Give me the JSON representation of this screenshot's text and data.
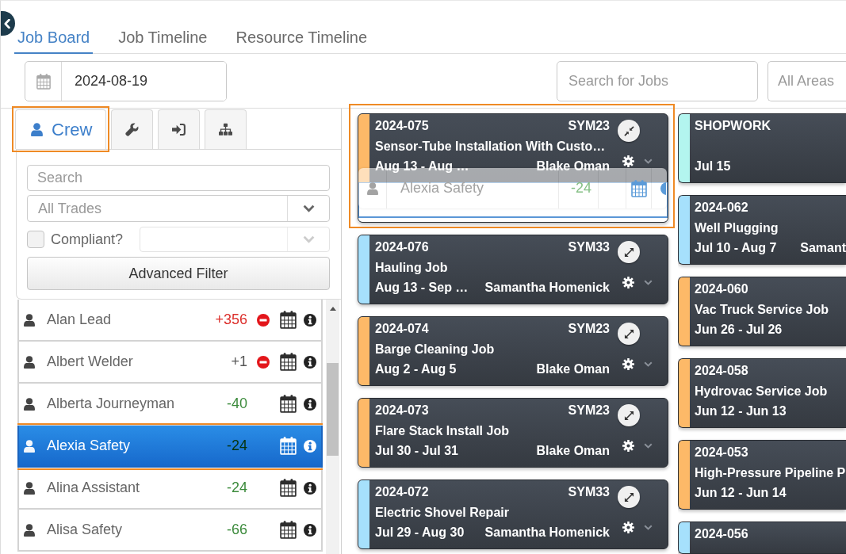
{
  "tabs": [
    {
      "label": "Job Board",
      "selected": true
    },
    {
      "label": "Job Timeline",
      "selected": false
    },
    {
      "label": "Resource Timeline",
      "selected": false
    }
  ],
  "toolbar": {
    "date": {
      "value": "2024-08-19"
    },
    "job_search": {
      "placeholder": "Search for Jobs"
    },
    "area_select": {
      "placeholder": "All Areas"
    }
  },
  "side_panel": {
    "tabs": [
      {
        "kind": "user",
        "label": "Crew",
        "selected": true,
        "highlighted": true
      },
      {
        "kind": "wrench",
        "selected": false,
        "highlighted": false
      },
      {
        "kind": "sign-in",
        "selected": false,
        "highlighted": false
      },
      {
        "kind": "sitemap",
        "selected": false,
        "highlighted": false
      }
    ],
    "filters": {
      "search": {
        "placeholder": "Search"
      },
      "trade_select": {
        "placeholder": "All Trades"
      },
      "compliant": {
        "label": "Compliant?",
        "checked": false
      },
      "compliance_select": {
        "disabled": true
      },
      "advanced_button": "Advanced Filter"
    },
    "crew": [
      {
        "name": "Alan Lead",
        "hours": "+356",
        "color": "#dc2f2b",
        "conflict": true,
        "selected": false,
        "highlighted": false
      },
      {
        "name": "Albert Welder",
        "hours": "+1",
        "color": "#555555",
        "conflict": true,
        "selected": false,
        "highlighted": false
      },
      {
        "name": "Alberta Journeyman",
        "hours": "-40",
        "color": "#3b8a3b",
        "conflict": false,
        "selected": false,
        "highlighted": false
      },
      {
        "name": "Alexia Safety",
        "hours": "-24",
        "color": "#06330c",
        "conflict": false,
        "selected": true,
        "highlighted": true
      },
      {
        "name": "Alina Assistant",
        "hours": "-24",
        "color": "#3b8a3b",
        "conflict": false,
        "selected": false,
        "highlighted": false
      },
      {
        "name": "Alisa Safety",
        "hours": "-66",
        "color": "#3b8a3b",
        "conflict": false,
        "selected": false,
        "highlighted": false
      }
    ]
  },
  "board": {
    "columns": [
      {
        "jobs": [
          {
            "number": "2024-075",
            "code": "SYM23",
            "title": "Sensor-Tube Installation With Custo…",
            "dates": "Aug 13 - Aug …",
            "person": "Blake Oman",
            "color": "#fdb968",
            "expanded": true,
            "highlighted": true,
            "drag_preview": {
              "name": "Alexia Safety",
              "hours": "-24"
            }
          },
          {
            "number": "2024-076",
            "code": "SYM33",
            "title": "Hauling Job",
            "dates": "Aug 13 - Sep …",
            "person": "Samantha Homenick",
            "color": "#a6e0fc",
            "expanded": false,
            "highlighted": false
          },
          {
            "number": "2024-074",
            "code": "SYM23",
            "title": "Barge Cleaning Job",
            "dates": "Aug 2 - Aug 5",
            "person": "Blake Oman",
            "color": "#fdb968",
            "expanded": false,
            "highlighted": false
          },
          {
            "number": "2024-073",
            "code": "SYM23",
            "title": "Flare Stack Install Job",
            "dates": "Jul 30 - Jul 31",
            "person": "Blake Oman",
            "color": "#fdb968",
            "expanded": false,
            "highlighted": false
          },
          {
            "number": "2024-072",
            "code": "SYM33",
            "title": "Electric Shovel Repair",
            "dates": "Jul 29 - Aug 30",
            "person": "Samantha Homenick",
            "color": "#a6e0fc",
            "expanded": false,
            "highlighted": false
          }
        ]
      },
      {
        "jobs": [
          {
            "number": "SHOPWORK",
            "dates": "Jul 15",
            "color": "#b3f5ef",
            "highlighted": false
          },
          {
            "number": "2024-062",
            "title": "Well Plugging",
            "dates": "Jul 10 - Aug 7",
            "person": "Samant",
            "color": "#a6e0fc",
            "highlighted": false
          },
          {
            "number": "2024-060",
            "title": "Vac Truck Service Job",
            "dates": "Jun 26 - Jul 26",
            "color": "#fdb968",
            "highlighted": false
          },
          {
            "number": "2024-058",
            "title": "Hydrovac Service Job",
            "dates": "Jun 12 - Jun 13",
            "color": "#fdb968",
            "highlighted": false
          },
          {
            "number": "2024-053",
            "title": "High-Pressure Pipeline P",
            "dates": "Jun 12 - Jun 14",
            "color": "#fdb968",
            "highlighted": false
          },
          {
            "number": "2024-056",
            "color": "#a6e0fc",
            "highlighted": false
          }
        ]
      }
    ]
  }
}
